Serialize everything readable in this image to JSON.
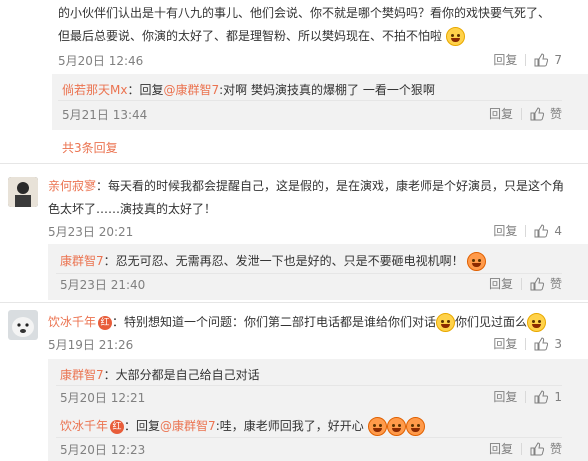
{
  "thread1": {
    "text_line1": "的小伙伴们认出是十有八九的事儿、他们会说、你不就是哪个樊妈吗？看你的戏快要气死了、",
    "text_line2": "但最后总要说、你演的太好了、都是理智粉、所以樊妈现在、不拍不怕啦",
    "time": "5月20日 12:46",
    "reply_label": "回复",
    "likes": "7",
    "subreply": {
      "author": "倘若那天Mx",
      "colon": "：",
      "reply_word": "回复",
      "mention": "@康群智7",
      "text": ":对啊 樊妈演技真的爆棚了 一看一个狠啊",
      "time": "5月21日 13:44",
      "reply_label": "回复",
      "like_label": "赞"
    },
    "more_label": "共3条回复"
  },
  "comment2": {
    "author": "亲何寂寥",
    "text_line1": "：每天看的时候我都会提醒自己，这是假的，是在演戏，康老师是个好演员，只是这个角",
    "text_line2": "色太坏了……演技真的太好了！",
    "time": "5月23日 20:21",
    "reply_label": "回复",
    "likes": "4",
    "subreply": {
      "author": "康群智7",
      "text": "：忍无可忍、无需再忍、发泄一下也是好的、只是不要砸电视机啊！",
      "time": "5月23日 21:40",
      "reply_label": "回复",
      "like_label": "赞"
    }
  },
  "comment3": {
    "author": "饮冰千年",
    "badge": "红",
    "text_a": "：特别想知道一个问题：你们第二部打电话都是谁给你们对话",
    "text_b": "你们见过面么",
    "time": "5月19日 21:26",
    "reply_label": "回复",
    "likes": "3",
    "subreply1": {
      "author": "康群智7",
      "text": "：大部分都是自己给自己对话",
      "time": "5月20日 12:21",
      "reply_label": "回复",
      "likes": "1"
    },
    "subreply2": {
      "author": "饮冰千年",
      "badge": "红",
      "colon": "：",
      "reply_word": "回复",
      "mention": "@康群智7",
      "text": ":哇，康老师回我了，好开心",
      "time": "5月20日 12:23",
      "reply_label": "回复",
      "like_label": "赞"
    }
  },
  "colors": {
    "link": "#eb7350",
    "green": "#5f9e41",
    "muted": "#808080",
    "bg_sub": "#f2f2f2"
  }
}
